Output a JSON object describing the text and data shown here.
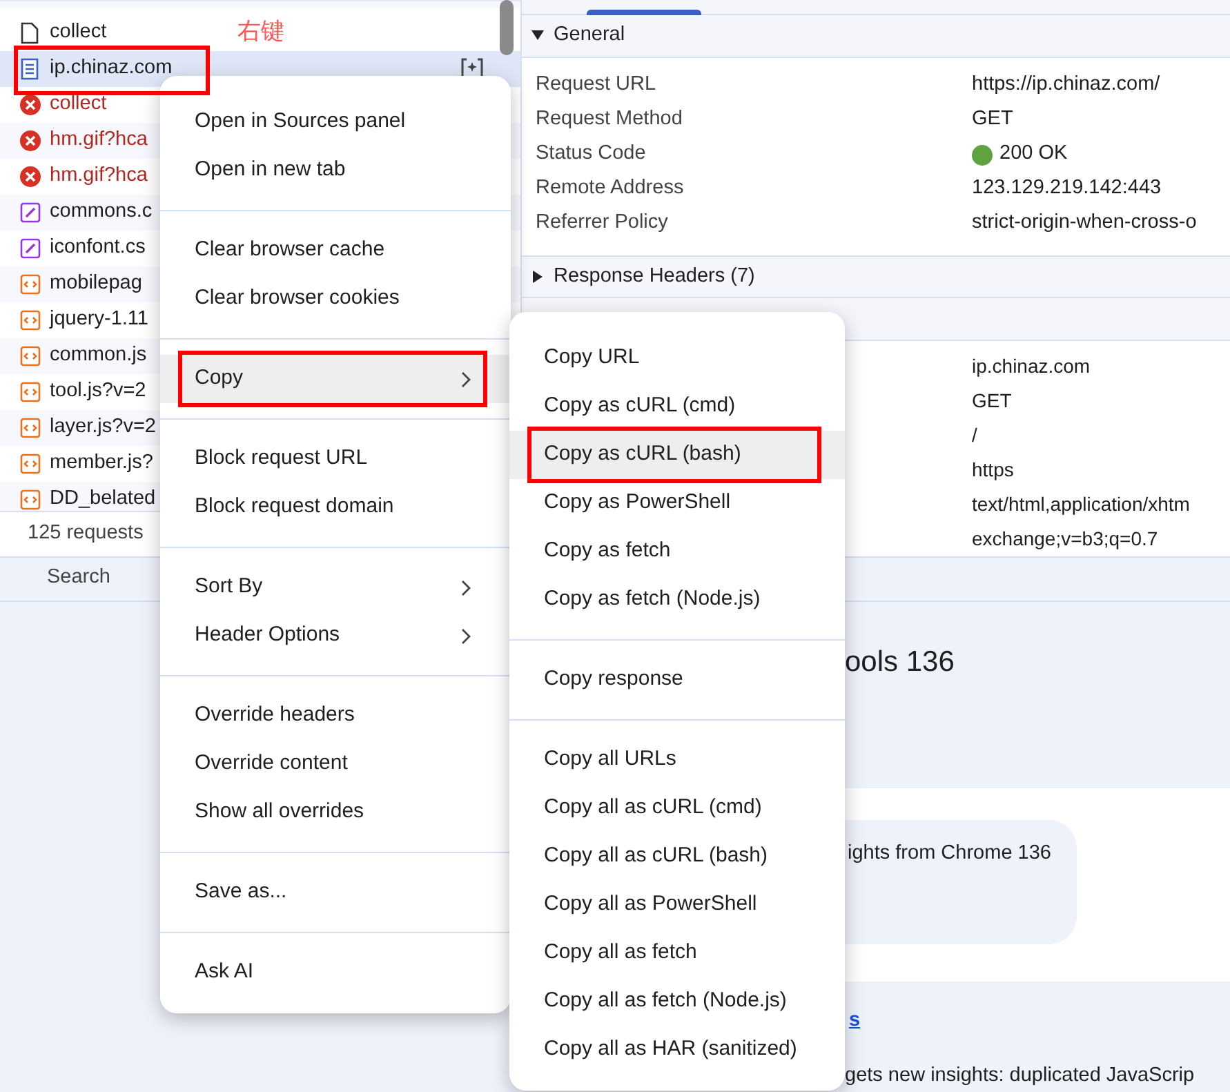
{
  "annotation": {
    "note": "右键"
  },
  "request_list": {
    "rows": [
      {
        "name": "collect",
        "kind": "blank",
        "selected": false,
        "highlighted": false
      },
      {
        "name": "ip.chinaz.com",
        "kind": "document",
        "selected": true,
        "highlighted": true
      },
      {
        "name": "collect",
        "kind": "error",
        "selected": false,
        "highlighted": false
      },
      {
        "name": "hm.gif?hca",
        "kind": "error",
        "selected": false,
        "highlighted": false
      },
      {
        "name": "hm.gif?hca",
        "kind": "error",
        "selected": false,
        "highlighted": false
      },
      {
        "name": "commons.c",
        "kind": "stylesheet",
        "selected": false,
        "highlighted": false
      },
      {
        "name": "iconfont.cs",
        "kind": "stylesheet",
        "selected": false,
        "highlighted": false
      },
      {
        "name": "mobilepag",
        "kind": "script",
        "selected": false,
        "highlighted": false
      },
      {
        "name": "jquery-1.11",
        "kind": "script",
        "selected": false,
        "highlighted": false
      },
      {
        "name": "common.js",
        "kind": "script",
        "selected": false,
        "highlighted": false
      },
      {
        "name": "tool.js?v=2",
        "kind": "script",
        "selected": false,
        "highlighted": false
      },
      {
        "name": "layer.js?v=2",
        "kind": "script",
        "selected": false,
        "highlighted": false
      },
      {
        "name": "member.js?",
        "kind": "script",
        "selected": false,
        "highlighted": false
      },
      {
        "name": "DD_belated",
        "kind": "script",
        "selected": false,
        "highlighted": false
      }
    ],
    "footer": "125 requests"
  },
  "headers_panel": {
    "general": {
      "title": "General",
      "expanded": true,
      "rows": [
        {
          "key": "Request URL",
          "value": "https://ip.chinaz.com/",
          "kind": "text"
        },
        {
          "key": "Request Method",
          "value": "GET",
          "kind": "text"
        },
        {
          "key": "Status Code",
          "value": "200 OK",
          "kind": "status",
          "color": "#5ea33e"
        },
        {
          "key": "Remote Address",
          "value": "123.129.219.142:443",
          "kind": "text"
        },
        {
          "key": "Referrer Policy",
          "value": "strict-origin-when-cross-o",
          "kind": "text"
        }
      ]
    },
    "response_headers": {
      "title": "Response Headers (7)",
      "expanded": false
    },
    "request_header_values": [
      "ip.chinaz.com",
      "GET",
      "/",
      "https",
      "text/html,application/xhtm\nexchange;v=b3;q=0.7"
    ]
  },
  "drawer": {
    "tabs": [
      {
        "label": "Search",
        "selected": false
      }
    ],
    "heading": "ools 136",
    "card_text": "ights from Chrome 136",
    "link": "s",
    "text": "gets new insights: duplicated JavaScrip"
  },
  "context_menu": {
    "groups": [
      [
        {
          "label": "Open in Sources panel",
          "submenu": false,
          "selected": false,
          "highlighted": false
        },
        {
          "label": "Open in new tab",
          "submenu": false,
          "selected": false,
          "highlighted": false
        }
      ],
      [
        {
          "label": "Clear browser cache",
          "submenu": false,
          "selected": false,
          "highlighted": false
        },
        {
          "label": "Clear browser cookies",
          "submenu": false,
          "selected": false,
          "highlighted": false
        }
      ],
      [
        {
          "label": "Copy",
          "submenu": true,
          "selected": true,
          "highlighted": true
        }
      ],
      [
        {
          "label": "Block request URL",
          "submenu": false,
          "selected": false,
          "highlighted": false
        },
        {
          "label": "Block request domain",
          "submenu": false,
          "selected": false,
          "highlighted": false
        }
      ],
      [
        {
          "label": "Sort By",
          "submenu": true,
          "selected": false,
          "highlighted": false
        },
        {
          "label": "Header Options",
          "submenu": true,
          "selected": false,
          "highlighted": false
        }
      ],
      [
        {
          "label": "Override headers",
          "submenu": false,
          "selected": false,
          "highlighted": false
        },
        {
          "label": "Override content",
          "submenu": false,
          "selected": false,
          "highlighted": false
        },
        {
          "label": "Show all overrides",
          "submenu": false,
          "selected": false,
          "highlighted": false
        }
      ],
      [
        {
          "label": "Save as...",
          "submenu": false,
          "selected": false,
          "highlighted": false
        }
      ],
      [
        {
          "label": "Ask AI",
          "submenu": false,
          "selected": false,
          "highlighted": false
        }
      ]
    ]
  },
  "copy_submenu": {
    "groups": [
      [
        {
          "label": "Copy URL",
          "selected": false,
          "highlighted": false
        },
        {
          "label": "Copy as cURL (cmd)",
          "selected": false,
          "highlighted": false
        },
        {
          "label": "Copy as cURL (bash)",
          "selected": true,
          "highlighted": true
        },
        {
          "label": "Copy as PowerShell",
          "selected": false,
          "highlighted": false
        },
        {
          "label": "Copy as fetch",
          "selected": false,
          "highlighted": false
        },
        {
          "label": "Copy as fetch (Node.js)",
          "selected": false,
          "highlighted": false
        }
      ],
      [
        {
          "label": "Copy response",
          "selected": false,
          "highlighted": false
        }
      ],
      [
        {
          "label": "Copy all URLs",
          "selected": false,
          "highlighted": false
        },
        {
          "label": "Copy all as cURL (cmd)",
          "selected": false,
          "highlighted": false
        },
        {
          "label": "Copy all as cURL (bash)",
          "selected": false,
          "highlighted": false
        },
        {
          "label": "Copy all as PowerShell",
          "selected": false,
          "highlighted": false
        },
        {
          "label": "Copy all as fetch",
          "selected": false,
          "highlighted": false
        },
        {
          "label": "Copy all as fetch (Node.js)",
          "selected": false,
          "highlighted": false
        },
        {
          "label": "Copy all as HAR (sanitized)",
          "selected": false,
          "highlighted": false
        }
      ]
    ]
  }
}
